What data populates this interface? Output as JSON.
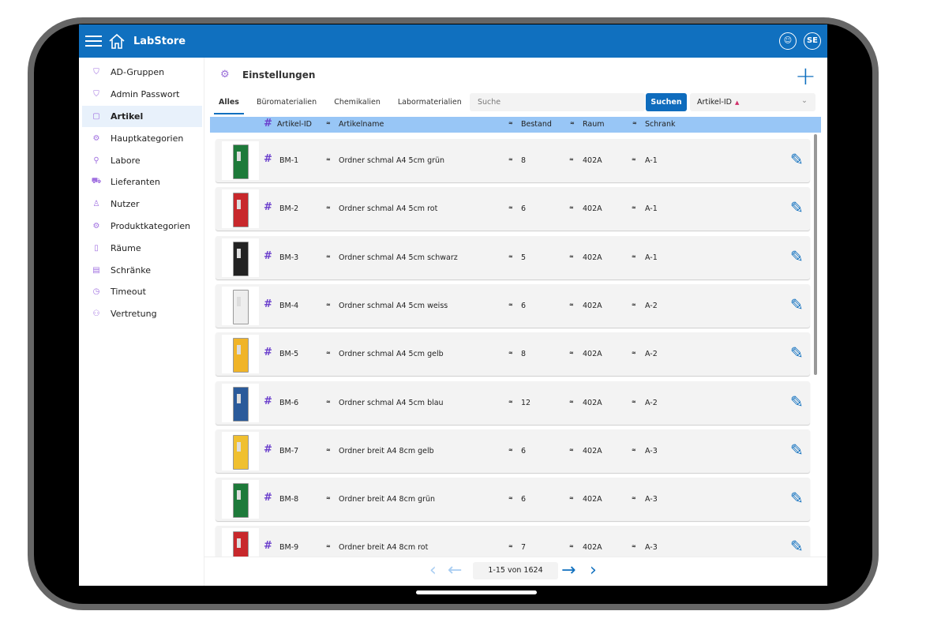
{
  "app": {
    "title": "LabStore",
    "user_initials": "SE"
  },
  "sidebar": {
    "items": [
      {
        "label": "AD-Gruppen",
        "icon": "shield-icon"
      },
      {
        "label": "Admin Passwort",
        "icon": "shield-icon"
      },
      {
        "label": "Artikel",
        "icon": "box-icon",
        "active": true
      },
      {
        "label": "Hauptkategorien",
        "icon": "gear-icon"
      },
      {
        "label": "Labore",
        "icon": "microscope-icon"
      },
      {
        "label": "Lieferanten",
        "icon": "truck-icon"
      },
      {
        "label": "Nutzer",
        "icon": "user-icon"
      },
      {
        "label": "Produktkategorien",
        "icon": "gear-icon"
      },
      {
        "label": "Räume",
        "icon": "door-icon"
      },
      {
        "label": "Schränke",
        "icon": "cabinet-icon"
      },
      {
        "label": "Timeout",
        "icon": "clock-icon"
      },
      {
        "label": "Vertretung",
        "icon": "users-icon"
      }
    ]
  },
  "page": {
    "title": "Einstellungen"
  },
  "tabs": [
    "Alles",
    "Büromaterialien",
    "Chemikalien",
    "Labormaterialien"
  ],
  "search": {
    "placeholder": "Suche",
    "button": "Suchen"
  },
  "sort": {
    "value": "Artikel-ID"
  },
  "columns": {
    "id": "Artikel-ID",
    "name": "Artikelname",
    "stock": "Bestand",
    "room": "Raum",
    "cabinet": "Schrank"
  },
  "rows": [
    {
      "id": "BM-1",
      "name": "Ordner schmal A4 5cm grün",
      "stock": "8",
      "room": "402A",
      "cabinet": "A-1",
      "color": "#1e7a3a"
    },
    {
      "id": "BM-2",
      "name": "Ordner schmal A4 5cm rot",
      "stock": "6",
      "room": "402A",
      "cabinet": "A-1",
      "color": "#c8282c"
    },
    {
      "id": "BM-3",
      "name": "Ordner schmal A4 5cm schwarz",
      "stock": "5",
      "room": "402A",
      "cabinet": "A-1",
      "color": "#222222"
    },
    {
      "id": "BM-4",
      "name": "Ordner schmal A4 5cm weiss",
      "stock": "6",
      "room": "402A",
      "cabinet": "A-2",
      "color": "#eeeeee"
    },
    {
      "id": "BM-5",
      "name": "Ordner schmal A4 5cm gelb",
      "stock": "8",
      "room": "402A",
      "cabinet": "A-2",
      "color": "#f0b428"
    },
    {
      "id": "BM-6",
      "name": "Ordner schmal A4 5cm blau",
      "stock": "12",
      "room": "402A",
      "cabinet": "A-2",
      "color": "#2a5a9a"
    },
    {
      "id": "BM-7",
      "name": "Ordner breit A4 8cm gelb",
      "stock": "6",
      "room": "402A",
      "cabinet": "A-3",
      "color": "#f0c030"
    },
    {
      "id": "BM-8",
      "name": "Ordner breit A4 8cm grün",
      "stock": "6",
      "room": "402A",
      "cabinet": "A-3",
      "color": "#1e7a3a"
    },
    {
      "id": "BM-9",
      "name": "Ordner breit A4 8cm rot",
      "stock": "7",
      "room": "402A",
      "cabinet": "A-3",
      "color": "#c8282c"
    }
  ],
  "pagination": {
    "text": "1-15 von 1624"
  }
}
